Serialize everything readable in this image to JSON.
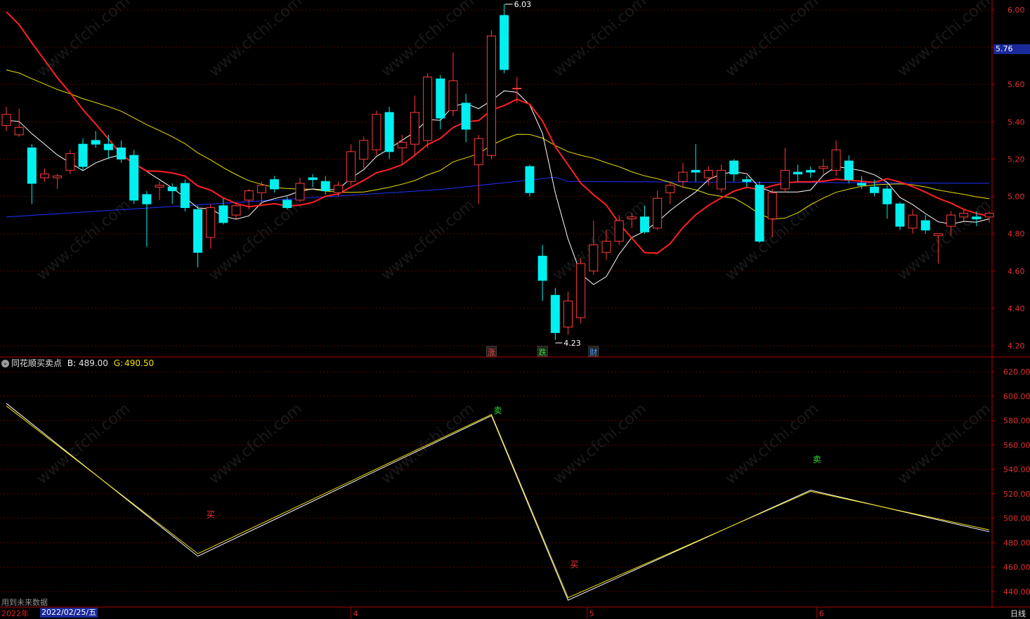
{
  "chart_data": [
    {
      "type": "candlestick",
      "yticks": [
        "6.00",
        "5.80",
        "5.60",
        "5.40",
        "5.20",
        "5.00",
        "4.80",
        "4.60",
        "4.40",
        "4.20"
      ],
      "ylim": [
        4.16,
        6.05
      ],
      "current_price": "5.76",
      "high_marker": "6.03",
      "low_marker": "4.23",
      "event_markers": [
        {
          "index": 38,
          "text": "涨",
          "color": "#ff4040"
        },
        {
          "index": 42,
          "text": "跌",
          "color": "#30e030"
        },
        {
          "index": 46,
          "text": "财",
          "color": "#4aa0ff"
        }
      ],
      "candles": [
        [
          5.38,
          5.44,
          5.35,
          5.48
        ],
        [
          5.33,
          5.37,
          5.32,
          5.47
        ],
        [
          5.26,
          5.07,
          4.96,
          5.28
        ],
        [
          5.1,
          5.12,
          5.08,
          5.15
        ],
        [
          5.1,
          5.11,
          5.04,
          5.12
        ],
        [
          5.14,
          5.23,
          5.12,
          5.25
        ],
        [
          5.28,
          5.16,
          5.14,
          5.31
        ],
        [
          5.3,
          5.28,
          5.26,
          5.35
        ],
        [
          5.28,
          5.25,
          5.2,
          5.33
        ],
        [
          5.26,
          5.2,
          5.18,
          5.3
        ],
        [
          5.22,
          4.98,
          4.96,
          5.25
        ],
        [
          5.01,
          4.96,
          4.73,
          5.03
        ],
        [
          5.05,
          5.06,
          4.98,
          5.08
        ],
        [
          5.05,
          5.03,
          4.96,
          5.07
        ],
        [
          5.07,
          4.94,
          4.92,
          5.09
        ],
        [
          4.93,
          4.7,
          4.62,
          4.95
        ],
        [
          4.78,
          4.94,
          4.72,
          4.96
        ],
        [
          4.95,
          4.86,
          4.85,
          4.99
        ],
        [
          4.9,
          4.95,
          4.88,
          4.97
        ],
        [
          4.98,
          5.03,
          4.93,
          5.04
        ],
        [
          5.02,
          5.06,
          4.96,
          5.08
        ],
        [
          5.09,
          5.04,
          5.02,
          5.11
        ],
        [
          4.98,
          4.94,
          4.93,
          5.0
        ],
        [
          4.98,
          5.07,
          4.97,
          5.1
        ],
        [
          5.1,
          5.09,
          5.05,
          5.12
        ],
        [
          5.08,
          5.03,
          5.01,
          5.11
        ],
        [
          5.02,
          5.06,
          5.0,
          5.08
        ],
        [
          5.08,
          5.24,
          5.06,
          5.28
        ],
        [
          5.2,
          5.3,
          5.15,
          5.32
        ],
        [
          5.25,
          5.44,
          5.22,
          5.46
        ],
        [
          5.45,
          5.24,
          5.2,
          5.48
        ],
        [
          5.26,
          5.29,
          5.17,
          5.33
        ],
        [
          5.28,
          5.45,
          5.22,
          5.54
        ],
        [
          5.3,
          5.64,
          5.26,
          5.66
        ],
        [
          5.63,
          5.42,
          5.36,
          5.65
        ],
        [
          5.46,
          5.62,
          5.43,
          5.77
        ],
        [
          5.5,
          5.36,
          5.29,
          5.55
        ],
        [
          5.17,
          5.31,
          4.96,
          5.33
        ],
        [
          5.22,
          5.86,
          5.2,
          5.89
        ],
        [
          5.97,
          5.68,
          5.66,
          6.03
        ],
        [
          5.58,
          5.58,
          5.5,
          5.64
        ],
        [
          5.16,
          5.02,
          5.0,
          5.17
        ],
        [
          4.68,
          4.55,
          4.44,
          4.74
        ],
        [
          4.47,
          4.27,
          4.23,
          4.51
        ],
        [
          4.3,
          4.44,
          4.26,
          4.49
        ],
        [
          4.35,
          4.64,
          4.32,
          4.67
        ],
        [
          4.6,
          4.74,
          4.58,
          4.87
        ],
        [
          4.7,
          4.76,
          4.66,
          4.82
        ],
        [
          4.76,
          4.87,
          4.74,
          4.9
        ],
        [
          4.88,
          4.89,
          4.83,
          4.91
        ],
        [
          4.89,
          4.81,
          4.8,
          4.95
        ],
        [
          4.83,
          4.99,
          4.82,
          5.03
        ],
        [
          5.02,
          5.06,
          4.96,
          5.08
        ],
        [
          5.08,
          5.13,
          5.05,
          5.18
        ],
        [
          5.14,
          5.13,
          5.08,
          5.28
        ],
        [
          5.1,
          5.14,
          5.06,
          5.16
        ],
        [
          5.04,
          5.14,
          5.02,
          5.17
        ],
        [
          5.19,
          5.12,
          5.08,
          5.2
        ],
        [
          5.09,
          5.08,
          5.05,
          5.11
        ],
        [
          5.06,
          4.76,
          4.75,
          5.08
        ],
        [
          4.88,
          5.02,
          4.78,
          5.04
        ],
        [
          5.04,
          5.14,
          5.02,
          5.26
        ],
        [
          5.13,
          5.12,
          5.08,
          5.17
        ],
        [
          5.14,
          5.13,
          5.1,
          5.16
        ],
        [
          5.15,
          5.16,
          5.12,
          5.2
        ],
        [
          5.14,
          5.25,
          5.11,
          5.3
        ],
        [
          5.19,
          5.09,
          5.07,
          5.22
        ],
        [
          5.07,
          5.06,
          5.04,
          5.11
        ],
        [
          5.05,
          5.02,
          5.0,
          5.09
        ],
        [
          5.04,
          4.96,
          4.88,
          5.06
        ],
        [
          4.96,
          4.84,
          4.82,
          4.97
        ],
        [
          4.83,
          4.9,
          4.8,
          4.93
        ],
        [
          4.87,
          4.82,
          4.8,
          4.9
        ],
        [
          4.79,
          4.8,
          4.64,
          4.8
        ],
        [
          4.84,
          4.9,
          4.79,
          4.92
        ],
        [
          4.89,
          4.91,
          4.87,
          4.93
        ],
        [
          4.89,
          4.88,
          4.84,
          4.92
        ],
        [
          4.89,
          4.91,
          4.86,
          4.92
        ]
      ]
    },
    {
      "type": "line",
      "title": "同花顺买卖点",
      "b_label": "B:",
      "b_value": "489.00",
      "g_label": "G:",
      "g_value": "490.50",
      "yticks": [
        "620.00",
        "600.00",
        "580.00",
        "560.00",
        "540.00",
        "520.00",
        "500.00",
        "480.00",
        "460.00",
        "440.00"
      ],
      "ylim": [
        431,
        626
      ],
      "series": [
        {
          "name": "B",
          "color": "#ffffff",
          "points": [
            [
              0,
              594
            ],
            [
              15,
              469
            ],
            [
              38,
              584
            ],
            [
              44,
              433
            ],
            [
              63,
              523
            ],
            [
              77,
              489
            ]
          ]
        },
        {
          "name": "G",
          "color": "#f0e000",
          "points": [
            [
              0,
              592
            ],
            [
              15,
              471
            ],
            [
              38,
              585
            ],
            [
              44,
              435
            ],
            [
              63,
              522
            ],
            [
              77,
              490.5
            ]
          ]
        }
      ],
      "signals": [
        {
          "index": 16,
          "value": 503,
          "text": "买",
          "color": "#ff3030"
        },
        {
          "index": 44.5,
          "value": 462,
          "text": "买",
          "color": "#ff3030"
        },
        {
          "index": 38.5,
          "value": 588,
          "text": "卖",
          "color": "#30e030"
        },
        {
          "index": 63.5,
          "value": 548,
          "text": "卖",
          "color": "#30e030"
        }
      ]
    }
  ],
  "footer": {
    "future_note": "用到未来数据",
    "year": "2022年",
    "date": "2022/02/25/五",
    "months": [
      {
        "index": 27,
        "label": "4"
      },
      {
        "index": 45.5,
        "label": "5"
      },
      {
        "index": 63.5,
        "label": "6"
      }
    ],
    "period": "日线"
  },
  "watermark": "www.cfchi.com",
  "colors": {
    "up": "#ff3b3b",
    "down": "#00f0f0",
    "ma5": "#ffffff",
    "ma10": "#ff2020",
    "ma20": "#e8e000",
    "ma60": "#2030ff",
    "axis": "#b00000",
    "grid": "#5a0000"
  }
}
